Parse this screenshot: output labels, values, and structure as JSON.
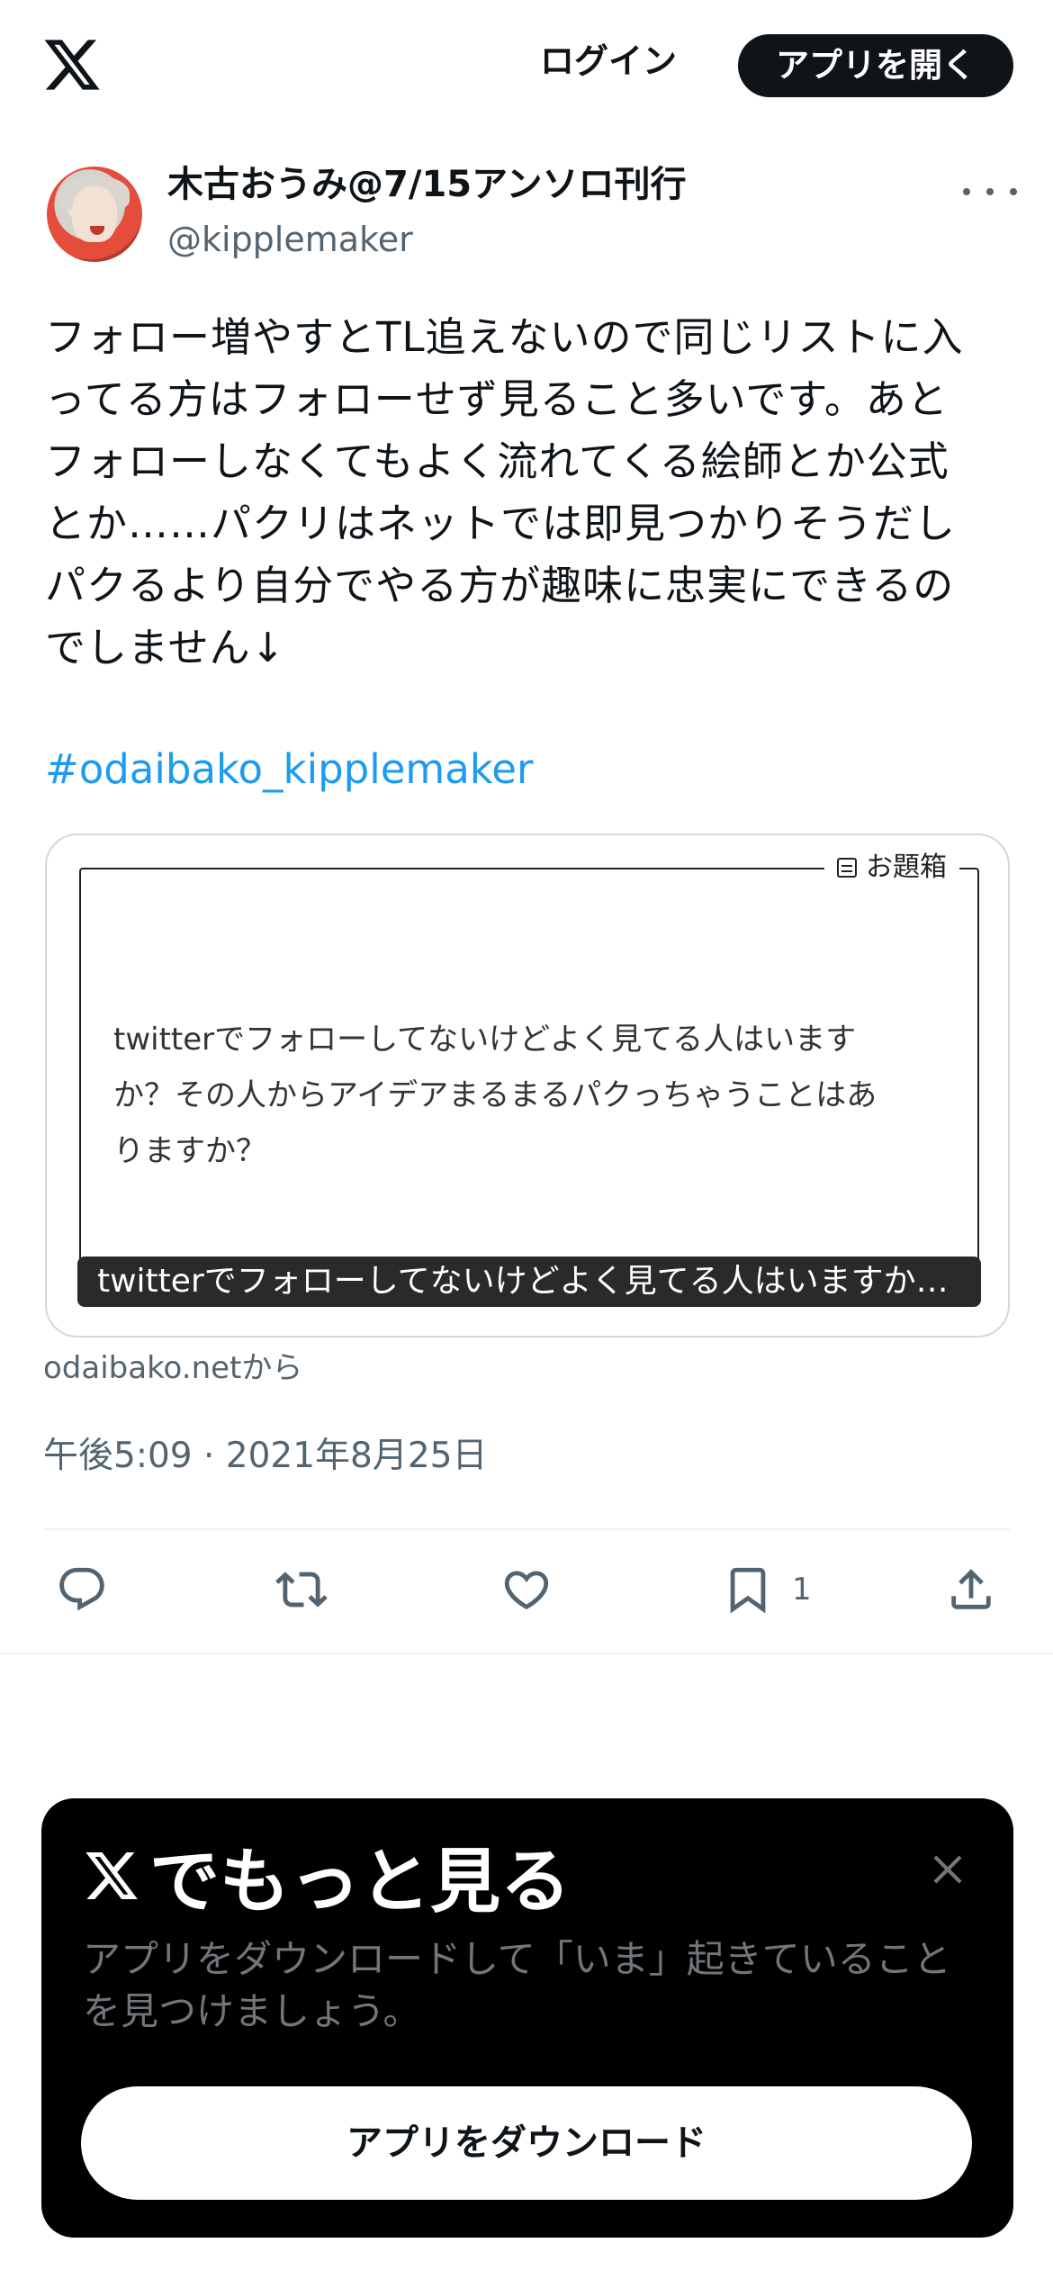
{
  "header": {
    "logo": "x-logo-icon",
    "login_label": "ログイン",
    "open_app_label": "アプリを開く"
  },
  "author": {
    "display_name": "木古おうみ@7/15アンソロ刊行",
    "handle": "@kipplemaker",
    "avatar": "avatar-illustration",
    "more": "more-icon"
  },
  "tweet": {
    "text": "フォロー増やすとTL追えないので同じリストに入\nってる方はフォローせず見ること多いです。あと\nフォローしなくてもよく流れてくる絵師とか公式\nとか……パクリはネットでは即見つかりそうだし\nパクるより自分でやる方が趣味に忠実にできるの\nでしません↓",
    "hashtag": "#odaibako_kipplemaker",
    "timestamp": "午後5:09 · 2021年8月25日"
  },
  "card": {
    "badge": "お題箱",
    "question": "twitterでフォローしてないけどよく見てる人はいます\nか？その人からアイデアまるまるパクっちゃうことはあ\nりますか？",
    "caption": "twitterでフォローしてないけどよく見てる人はいますか…",
    "source": "odaibako.netから"
  },
  "actions": {
    "reply_icon": "reply-icon",
    "retweet_icon": "retweet-icon",
    "like_icon": "heart-icon",
    "bookmark_icon": "bookmark-icon",
    "bookmark_count": "1",
    "share_icon": "share-icon"
  },
  "promo": {
    "title": "でもっと見る",
    "text": "アプリをダウンロードして「いま」起きていること\nを見つけましょう。",
    "download_label": "アプリをダウンロード",
    "close_icon": "close-icon"
  },
  "colors": {
    "text": "#0f1419",
    "secondary": "#536471",
    "link": "#1d9bf0",
    "promo_bg": "#000000",
    "promo_text": "#71767b"
  }
}
